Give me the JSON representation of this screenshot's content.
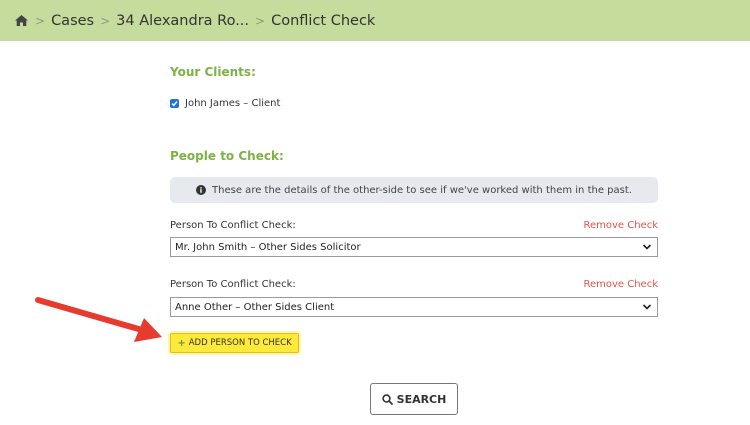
{
  "breadcrumb": {
    "home_icon": "home-icon",
    "items": [
      "Cases",
      "34 Alexandra Ro...",
      "Conflict Check"
    ],
    "separator": ">"
  },
  "clients": {
    "title": "Your Clients:",
    "items": [
      {
        "label": "John James – Client",
        "checked": true
      }
    ]
  },
  "people": {
    "title": "People to Check:",
    "info": "These are the details of the other-side to see if we've worked with them in the past.",
    "checks": [
      {
        "label": "Person To Conflict Check:",
        "remove_label": "Remove Check",
        "selected": "Mr. John Smith – Other Sides Solicitor"
      },
      {
        "label": "Person To Conflict Check:",
        "remove_label": "Remove Check",
        "selected": "Anne Other – Other Sides Client"
      }
    ]
  },
  "add_button": {
    "label": "ADD PERSON TO CHECK",
    "icon": "plus-icon"
  },
  "search_button": {
    "label": "SEARCH",
    "icon": "search-icon"
  },
  "colors": {
    "breadcrumb_bg": "#c5dc9d",
    "section_title": "#7cb342",
    "remove_link": "#e5534b",
    "add_button_bg": "#ffe93b",
    "arrow": "#e63b2e",
    "checkbox": "#1f73d6"
  }
}
